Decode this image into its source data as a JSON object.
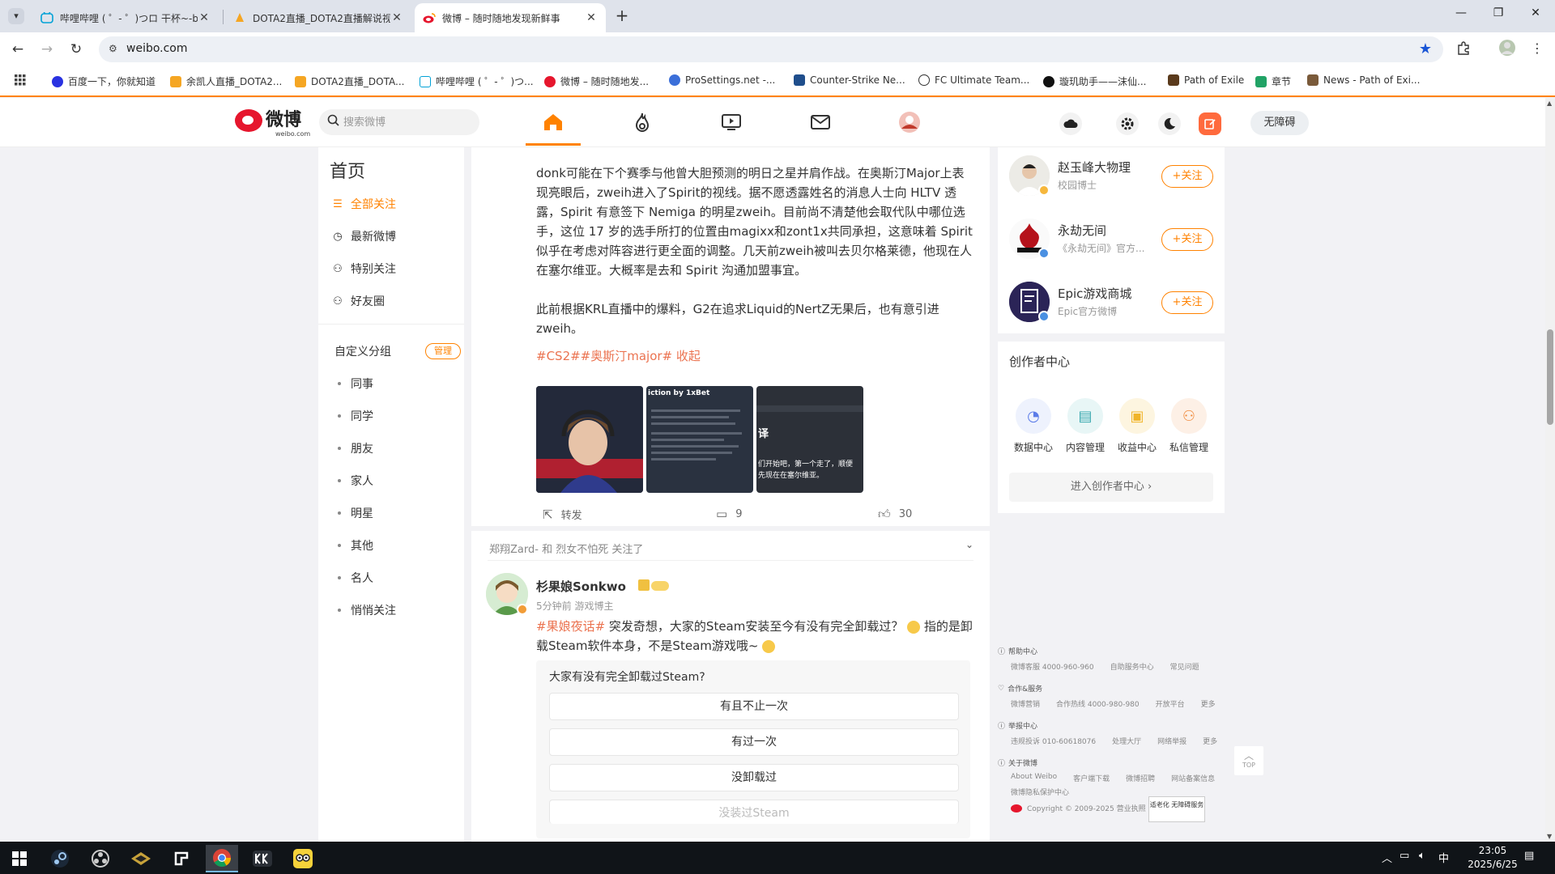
{
  "browser": {
    "tabs": [
      {
        "title": "哔哩哔哩 ( ゜- ゜)つロ 干杯~-bili",
        "active": false
      },
      {
        "title": "DOTA2直播_DOTA2直播解说视",
        "active": false
      },
      {
        "title": "微博 – 随时随地发现新鲜事",
        "active": true
      }
    ],
    "url": "weibo.com",
    "bookmarks": [
      "百度一下，你就知道",
      "余凯人直播_DOTA2...",
      "DOTA2直播_DOTA...",
      "哔哩哔哩 ( ゜- ゜)つ...",
      "微博 – 随时随地发...",
      "ProSettings.net -...",
      "Counter-Strike Ne...",
      "FC Ultimate Team...",
      "璇玑助手——沫仙...",
      "Path of Exile",
      "章节",
      "News - Path of Exi..."
    ]
  },
  "weibo_nav": {
    "logo_text": "微博",
    "logo_sub": "weibo.com",
    "search_placeholder": "搜索微博",
    "accessibility_button": "无障碍"
  },
  "left_sidebar": {
    "title": "首页",
    "items": [
      "全部关注",
      "最新微博",
      "特别关注",
      "好友圈"
    ],
    "custom_group_title": "自定义分组",
    "manage_label": "管理",
    "groups": [
      "同事",
      "同学",
      "朋友",
      "家人",
      "明星",
      "其他",
      "名人",
      "悄悄关注"
    ]
  },
  "post1": {
    "paragraph1": "donk可能在下个赛季与他曾大胆预测的明日之星并肩作战。在奥斯汀Major上表现亮眼后，zweih进入了Spirit的视线。据不愿透露姓名的消息人士向 HLTV 透露，Spirit 有意签下 Nemiga 的明星zweih。目前尚不清楚他会取代队中哪位选手，这位 17 岁的选手所打的位置由magixx和zont1x共同承担，这意味着 Spirit 似乎在考虑对阵容进行更全面的调整。几天前zweih被叫去贝尔格莱德，他现在人在塞尔维亚。大概率是去和 Spirit 沟通加盟事宜。",
    "paragraph2": "此前根据KRL直播中的爆料，G2在追求Liquid的NertZ无果后，也有意引进zweih。",
    "tags": "#CS2##奥斯汀major#",
    "collapse_label": "收起",
    "thumb2_caption": "iction by 1xBet",
    "thumb3_text": "们开始吧，第一个走了，顺便 先现在在塞尔维亚。",
    "thumb3_big": "译",
    "repost_label": "转发",
    "comment_count": "9",
    "like_count": "30"
  },
  "post2": {
    "context": "郑翔Zard- 和 烈女不怕死 关注了",
    "author": "杉果娘Sonkwo",
    "meta": "5分钟前 游戏博主",
    "tag": "#果娘夜话#",
    "text": "突发奇想，大家的Steam安装至今有没有完全卸载过？",
    "text_tail": "指的是卸载Steam软件本身，不是Steam游戏哦~",
    "poll_question": "大家有没有完全卸载过Steam?",
    "poll_options": [
      "有且不止一次",
      "有过一次",
      "没卸载过",
      "没装过Steam"
    ]
  },
  "recommend": [
    {
      "name": "赵玉峰大物理",
      "desc": "校园博士",
      "follow": "+关注"
    },
    {
      "name": "永劫无间",
      "desc": "《永劫无间》官方...",
      "follow": "+关注"
    },
    {
      "name": "Epic游戏商城",
      "desc": "Epic官方微博",
      "follow": "+关注"
    }
  ],
  "creator_center": {
    "title": "创作者中心",
    "items": [
      "数据中心",
      "内容管理",
      "收益中心",
      "私信管理"
    ],
    "enter": "进入创作者中心"
  },
  "footer": {
    "help_title": "帮助中心",
    "help_items": [
      "微博客服 4000-960-960",
      "自助服务中心",
      "常见问题"
    ],
    "coop_title": "合作&服务",
    "coop_items": [
      "微博营销",
      "合作热线 4000-980-980",
      "开放平台",
      "更多"
    ],
    "report_title": "举报中心",
    "report_items": [
      "违规投诉 010-60618076",
      "处理大厅",
      "网络举报",
      "更多"
    ],
    "about_title": "关于微博",
    "about_items": [
      "About Weibo",
      "客户端下载",
      "微博招聘",
      "网站备案信息"
    ],
    "privacy": "微博隐私保护中心",
    "copyright": "Copyright © 2009-2025 营业执照",
    "elder_badge": "适老化 无障碍服务",
    "top_label": "TOP"
  },
  "taskbar": {
    "ime": "中",
    "time": "23:05",
    "date": "2025/6/25"
  }
}
